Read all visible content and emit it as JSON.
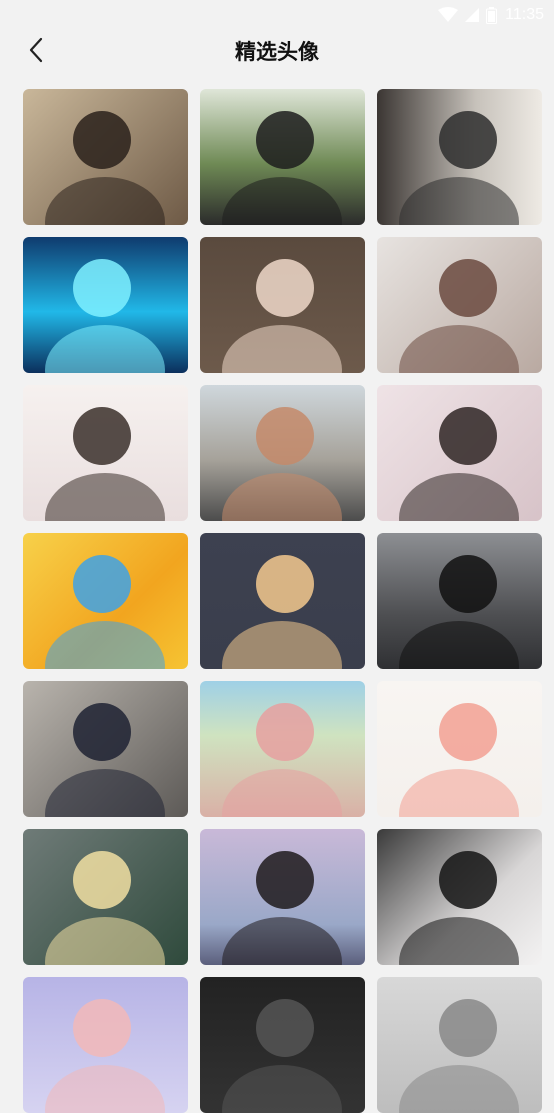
{
  "status_bar": {
    "time": "11:35"
  },
  "header": {
    "title": "精选头像",
    "back_icon": "chevron-left-icon"
  },
  "avatars": [
    {
      "name": "avatar-couple-portrait",
      "bg": "linear-gradient(135deg,#c9b79a,#6e5a46)",
      "fg": "#2a211b"
    },
    {
      "name": "avatar-hoodie-with-cat",
      "bg": "linear-gradient(180deg,#dfe6d8 0%,#6f8a55 55%,#2b2b2b 100%)",
      "fg": "#1d1d1d"
    },
    {
      "name": "avatar-boy-by-window",
      "bg": "linear-gradient(90deg,#3b3633,#c7c2bb 60%,#eeeae4)",
      "fg": "#2e2e2e"
    },
    {
      "name": "avatar-anime-blue-hair",
      "bg": "linear-gradient(180deg,#0f3b6e,#21b8e8 55%,#0b2f5c)",
      "fg": "#7ff0ff"
    },
    {
      "name": "avatar-illustrated-girl",
      "bg": "linear-gradient(180deg,#5a4a3e,#6d5a4b)",
      "fg": "#efd8c9"
    },
    {
      "name": "avatar-girl-white-shirt",
      "bg": "linear-gradient(135deg,#e7e3e0,#b9a9a1)",
      "fg": "#6b4a40"
    },
    {
      "name": "avatar-anime-dark-hair",
      "bg": "linear-gradient(180deg,#f6f1ef,#e9dede)",
      "fg": "#3a2f2a"
    },
    {
      "name": "avatar-girl-city-view",
      "bg": "linear-gradient(180deg,#cfd7dc 0%,#a6a29a 55%,#4c4c4c 100%)",
      "fg": "#c48a6a"
    },
    {
      "name": "avatar-girl-with-kitten",
      "bg": "linear-gradient(135deg,#efe3e6,#d7c3c8)",
      "fg": "#2f2624"
    },
    {
      "name": "avatar-cartoon-blue-cat",
      "bg": "linear-gradient(135deg,#f7d14a,#f2a51f 60%,#f6c433)",
      "fg": "#3ea2e6"
    },
    {
      "name": "avatar-girl-red-bow",
      "bg": "linear-gradient(180deg,#3d4150,#3a3e4c)",
      "fg": "#f3c98e"
    },
    {
      "name": "avatar-black-jacket-street",
      "bg": "linear-gradient(180deg,#8d8f93,#4e4f52 60%,#2f3033)",
      "fg": "#111111"
    },
    {
      "name": "avatar-school-couple",
      "bg": "linear-gradient(135deg,#b9b4ad,#5d5a57)",
      "fg": "#1f2233"
    },
    {
      "name": "avatar-cartoon-scooter",
      "bg": "linear-gradient(180deg,#9fd0e6 0%,#cfe3c0 40%,#d9b0a6 100%)",
      "fg": "#e6a0a0"
    },
    {
      "name": "avatar-pink-flower",
      "bg": "linear-gradient(180deg,#f8f5f2,#f4f0ec)",
      "fg": "#f2a093"
    },
    {
      "name": "avatar-blonde-boy",
      "bg": "linear-gradient(135deg,#6f7b78,#2f4a3c)",
      "fg": "#f1dfa2"
    },
    {
      "name": "avatar-couple-embrace",
      "bg": "linear-gradient(180deg,#c9b9d8,#9aa8c8 70%,#5b5f7c)",
      "fg": "#1f1a1c"
    },
    {
      "name": "avatar-girl-headphones",
      "bg": "linear-gradient(135deg,#3a3a3a,#d8d6d6 60%,#f3f2f2)",
      "fg": "#141414"
    },
    {
      "name": "avatar-partial-1",
      "bg": "linear-gradient(180deg,#b7b4e6,#d6d3f1)",
      "fg": "#f2b8b8"
    },
    {
      "name": "avatar-partial-2",
      "bg": "linear-gradient(180deg,#222222,#333333)",
      "fg": "#555555"
    },
    {
      "name": "avatar-partial-3",
      "bg": "linear-gradient(180deg,#d8d8d8,#bdbdbd)",
      "fg": "#888888"
    }
  ]
}
